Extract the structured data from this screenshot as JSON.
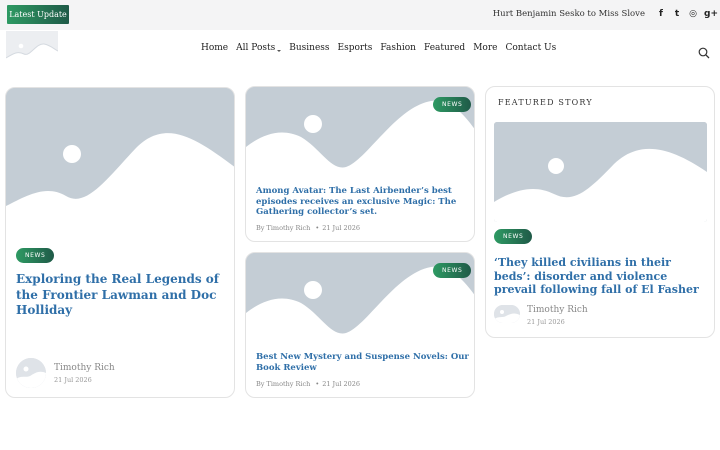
{
  "topbar": {
    "latest_label": "Latest Update",
    "ticker_text": "Hurt Benjamin Sesko to Miss Slove",
    "social_icons": [
      "facebook-icon",
      "twitter-icon",
      "instagram-icon",
      "google-plus-icon"
    ],
    "social_glyphs": [
      "f",
      "t",
      "◎",
      "g+"
    ]
  },
  "nav": {
    "items": [
      {
        "label": "Home",
        "dropdown": false
      },
      {
        "label": "All Posts",
        "dropdown": true
      },
      {
        "label": "Business",
        "dropdown": false
      },
      {
        "label": "Esports",
        "dropdown": false
      },
      {
        "label": "Fashion",
        "dropdown": false
      },
      {
        "label": "Featured",
        "dropdown": false
      },
      {
        "label": "More",
        "dropdown": false
      },
      {
        "label": "Contact Us",
        "dropdown": false
      }
    ]
  },
  "colors": {
    "accent_green": "#2e9a63",
    "accent_dark": "#1f5a48",
    "title_blue": "#2f6fa8",
    "placeholder_bg": "#c4cdd5"
  },
  "main_card": {
    "tag": "NEWS",
    "title": "Exploring the Real Legends of the Frontier Lawman and Doc Holliday",
    "author": "Timothy Rich",
    "date": "21 Jul 2026"
  },
  "mid_cards": [
    {
      "tag": "NEWS",
      "title": "Among Avatar: The Last Airbender’s best episodes receives an exclusive Magic: The Gathering collector’s set.",
      "by": "By Timothy Rich",
      "date": "21 Jul 2026"
    },
    {
      "tag": "NEWS",
      "title": "Best New Mystery and Suspense Novels: Our Book Review",
      "by": "By Timothy Rich",
      "date": "21 Jul 2026"
    }
  ],
  "featured": {
    "label": "FEATURED STORY",
    "tag": "NEWS",
    "title": "‘They killed civilians in their beds’: disorder and violence prevail following fall of El Fasher",
    "author": "Timothy Rich",
    "date": "21 Jul 2026"
  }
}
